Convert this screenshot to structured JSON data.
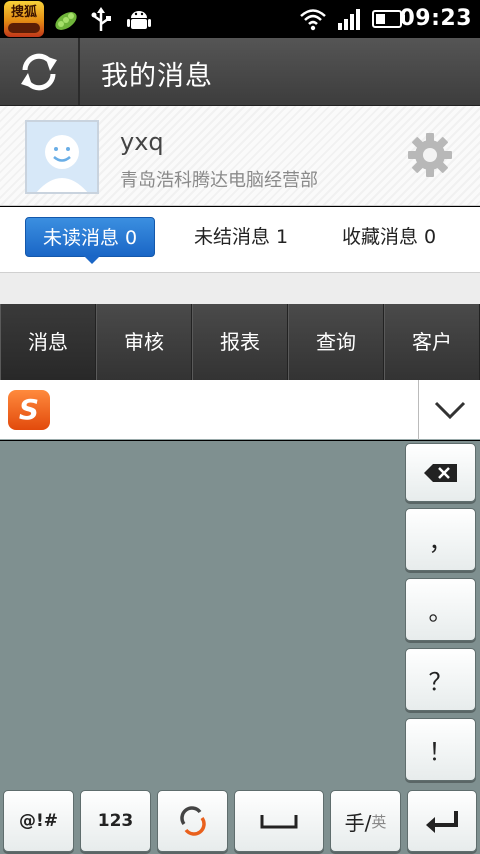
{
  "status_bar": {
    "app_icon_text": "搜狐",
    "time": "09:23"
  },
  "header": {
    "title": "我的消息"
  },
  "profile": {
    "username": "yxq",
    "company": "青岛浩科腾达电脑经营部"
  },
  "message_tabs": [
    {
      "label": "未读消息",
      "count": "0"
    },
    {
      "label": "未结消息",
      "count": "1"
    },
    {
      "label": "收藏消息",
      "count": "0"
    }
  ],
  "bottom_nav": [
    "消息",
    "审核",
    "报表",
    "查询",
    "客户"
  ],
  "ime": {
    "logo_letter": "S"
  },
  "keyboard": {
    "punct_keys": [
      "，",
      "。",
      "？",
      "！"
    ],
    "bottom_keys": {
      "symbols": "@!#",
      "numbers": "123",
      "hand_main": "手/",
      "hand_alt": "英"
    }
  },
  "colors": {
    "accent_blue": "#1a66c6",
    "title_bar": "#474747",
    "keyboard_bg": "#7f9090"
  }
}
